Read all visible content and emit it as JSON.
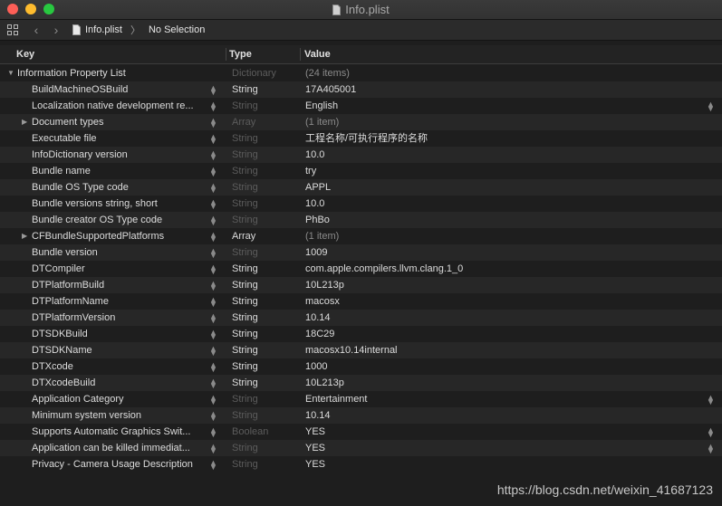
{
  "window": {
    "title": "Info.plist"
  },
  "jumpbar": {
    "file": "Info.plist",
    "selection": "No Selection"
  },
  "columns": {
    "key": "Key",
    "type": "Type",
    "value": "Value"
  },
  "root": {
    "key": "Information Property List",
    "type": "Dictionary",
    "value": "(24 items)"
  },
  "rows": [
    {
      "key": "BuildMachineOSBuild",
      "type": "String",
      "type_dim": false,
      "value": "17A405001",
      "value_dim": false,
      "expandable": false,
      "value_stepper": false
    },
    {
      "key": "Localization native development re...",
      "type": "String",
      "type_dim": true,
      "value": "English",
      "value_dim": false,
      "expandable": false,
      "value_stepper": true
    },
    {
      "key": "Document types",
      "type": "Array",
      "type_dim": true,
      "value": "(1 item)",
      "value_dim": true,
      "expandable": true,
      "value_stepper": false
    },
    {
      "key": "Executable file",
      "type": "String",
      "type_dim": true,
      "value": "工程名称/可执行程序的名称",
      "value_dim": false,
      "expandable": false,
      "value_stepper": false
    },
    {
      "key": "InfoDictionary version",
      "type": "String",
      "type_dim": true,
      "value": "10.0",
      "value_dim": false,
      "expandable": false,
      "value_stepper": false
    },
    {
      "key": "Bundle name",
      "type": "String",
      "type_dim": true,
      "value": "try",
      "value_dim": false,
      "expandable": false,
      "value_stepper": false
    },
    {
      "key": "Bundle OS Type code",
      "type": "String",
      "type_dim": true,
      "value": "APPL",
      "value_dim": false,
      "expandable": false,
      "value_stepper": false
    },
    {
      "key": "Bundle versions string, short",
      "type": "String",
      "type_dim": true,
      "value": "10.0",
      "value_dim": false,
      "expandable": false,
      "value_stepper": false
    },
    {
      "key": "Bundle creator OS Type code",
      "type": "String",
      "type_dim": true,
      "value": "PhBo",
      "value_dim": false,
      "expandable": false,
      "value_stepper": false
    },
    {
      "key": "CFBundleSupportedPlatforms",
      "type": "Array",
      "type_dim": false,
      "value": "(1 item)",
      "value_dim": true,
      "expandable": true,
      "value_stepper": false
    },
    {
      "key": "Bundle version",
      "type": "String",
      "type_dim": true,
      "value": "1009",
      "value_dim": false,
      "expandable": false,
      "value_stepper": false
    },
    {
      "key": "DTCompiler",
      "type": "String",
      "type_dim": false,
      "value": "com.apple.compilers.llvm.clang.1_0",
      "value_dim": false,
      "expandable": false,
      "value_stepper": false
    },
    {
      "key": "DTPlatformBuild",
      "type": "String",
      "type_dim": false,
      "value": "10L213p",
      "value_dim": false,
      "expandable": false,
      "value_stepper": false
    },
    {
      "key": "DTPlatformName",
      "type": "String",
      "type_dim": false,
      "value": "macosx",
      "value_dim": false,
      "expandable": false,
      "value_stepper": false
    },
    {
      "key": "DTPlatformVersion",
      "type": "String",
      "type_dim": false,
      "value": "10.14",
      "value_dim": false,
      "expandable": false,
      "value_stepper": false
    },
    {
      "key": "DTSDKBuild",
      "type": "String",
      "type_dim": false,
      "value": "18C29",
      "value_dim": false,
      "expandable": false,
      "value_stepper": false
    },
    {
      "key": "DTSDKName",
      "type": "String",
      "type_dim": false,
      "value": "macosx10.14internal",
      "value_dim": false,
      "expandable": false,
      "value_stepper": false
    },
    {
      "key": "DTXcode",
      "type": "String",
      "type_dim": false,
      "value": "1000",
      "value_dim": false,
      "expandable": false,
      "value_stepper": false
    },
    {
      "key": "DTXcodeBuild",
      "type": "String",
      "type_dim": false,
      "value": "10L213p",
      "value_dim": false,
      "expandable": false,
      "value_stepper": false
    },
    {
      "key": "Application Category",
      "type": "String",
      "type_dim": true,
      "value": "Entertainment",
      "value_dim": false,
      "expandable": false,
      "value_stepper": true
    },
    {
      "key": "Minimum system version",
      "type": "String",
      "type_dim": true,
      "value": "10.14",
      "value_dim": false,
      "expandable": false,
      "value_stepper": false
    },
    {
      "key": "Supports Automatic Graphics Swit...",
      "type": "Boolean",
      "type_dim": true,
      "value": "YES",
      "value_dim": false,
      "expandable": false,
      "value_stepper": true
    },
    {
      "key": "Application can be killed immediat...",
      "type": "String",
      "type_dim": true,
      "value": "YES",
      "value_dim": false,
      "expandable": false,
      "value_stepper": true
    },
    {
      "key": "Privacy - Camera Usage Description",
      "type": "String",
      "type_dim": true,
      "value": "YES",
      "value_dim": false,
      "expandable": false,
      "value_stepper": false
    }
  ],
  "watermark": "https://blog.csdn.net/weixin_41687123",
  "colors": {
    "traffic_close": "#fe5f57",
    "traffic_min": "#febc2e",
    "traffic_max": "#28c840"
  }
}
